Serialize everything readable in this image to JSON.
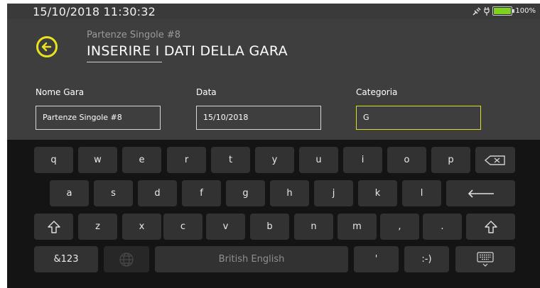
{
  "status": {
    "datetime": "15/10/2018  11:30:32",
    "battery_percent": "100%",
    "battery_level": 1.0
  },
  "header": {
    "subtitle": "Partenze Singole #8",
    "title": "INSERIRE I DATI DELLA GARA",
    "back_icon": "arrow-left-circle-icon"
  },
  "form": {
    "fields": [
      {
        "label": "Nome Gara",
        "value": "Partenze Singole #8"
      },
      {
        "label": "Data",
        "value": "15/10/2018"
      },
      {
        "label": "Categoria",
        "value": "G"
      }
    ]
  },
  "keyboard": {
    "row1": [
      "q",
      "w",
      "e",
      "r",
      "t",
      "y",
      "u",
      "i",
      "o",
      "p"
    ],
    "row2": [
      "a",
      "s",
      "d",
      "f",
      "g",
      "h",
      "j",
      "k",
      "l"
    ],
    "row3": [
      "z",
      "x",
      "c",
      "v",
      "b",
      "n",
      "m",
      ",",
      "."
    ],
    "symbols_label": "&123",
    "space_label": "British English",
    "apostrophe": "'",
    "emoticon": ":-)",
    "colors": {
      "accent": "#e7e31f",
      "key": "#323232",
      "keyboard_bg": "#141414",
      "app_bg": "#3e3e3e"
    }
  }
}
